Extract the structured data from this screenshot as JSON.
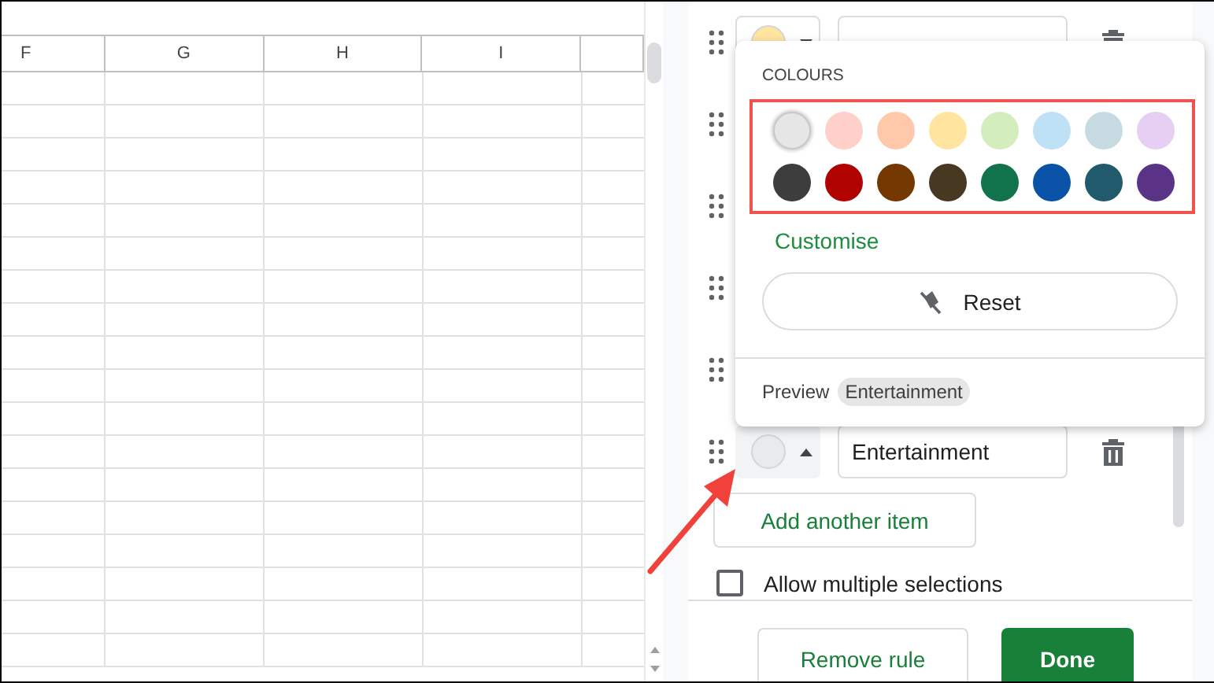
{
  "sheet": {
    "columns": [
      "F",
      "G",
      "H",
      "I"
    ]
  },
  "items": [
    {
      "kind": "row",
      "color": "#ffe5a0",
      "expanded": false
    },
    {
      "kind": "covered"
    },
    {
      "kind": "covered"
    },
    {
      "kind": "covered"
    },
    {
      "kind": "covered"
    },
    {
      "kind": "row",
      "color": "#e8eaed",
      "value": "Entertainment",
      "expanded": true
    }
  ],
  "add_button": "Add another item",
  "multiple_selections": {
    "label": "Allow multiple selections",
    "checked": false
  },
  "colour_menu": {
    "heading": "COLOURS",
    "swatches": [
      {
        "color": "#e6e6e6",
        "selected": true
      },
      {
        "color": "#ffcfc9",
        "selected": false
      },
      {
        "color": "#ffc8aa",
        "selected": false
      },
      {
        "color": "#ffe5a0",
        "selected": false
      },
      {
        "color": "#d4edbc",
        "selected": false
      },
      {
        "color": "#bfe1f6",
        "selected": false
      },
      {
        "color": "#c6dbe1",
        "selected": false
      },
      {
        "color": "#e6cff2",
        "selected": false
      },
      {
        "color": "#3d3d3d",
        "selected": false
      },
      {
        "color": "#b10202",
        "selected": false
      },
      {
        "color": "#753800",
        "selected": false
      },
      {
        "color": "#473821",
        "selected": false
      },
      {
        "color": "#11734b",
        "selected": false
      },
      {
        "color": "#0a53a8",
        "selected": false
      },
      {
        "color": "#215a6c",
        "selected": false
      },
      {
        "color": "#5a3286",
        "selected": false
      }
    ],
    "customise": "Customise",
    "reset": "Reset",
    "preview_label": "Preview",
    "preview_chip": "Entertainment"
  },
  "footer": {
    "remove": "Remove rule",
    "done": "Done"
  }
}
